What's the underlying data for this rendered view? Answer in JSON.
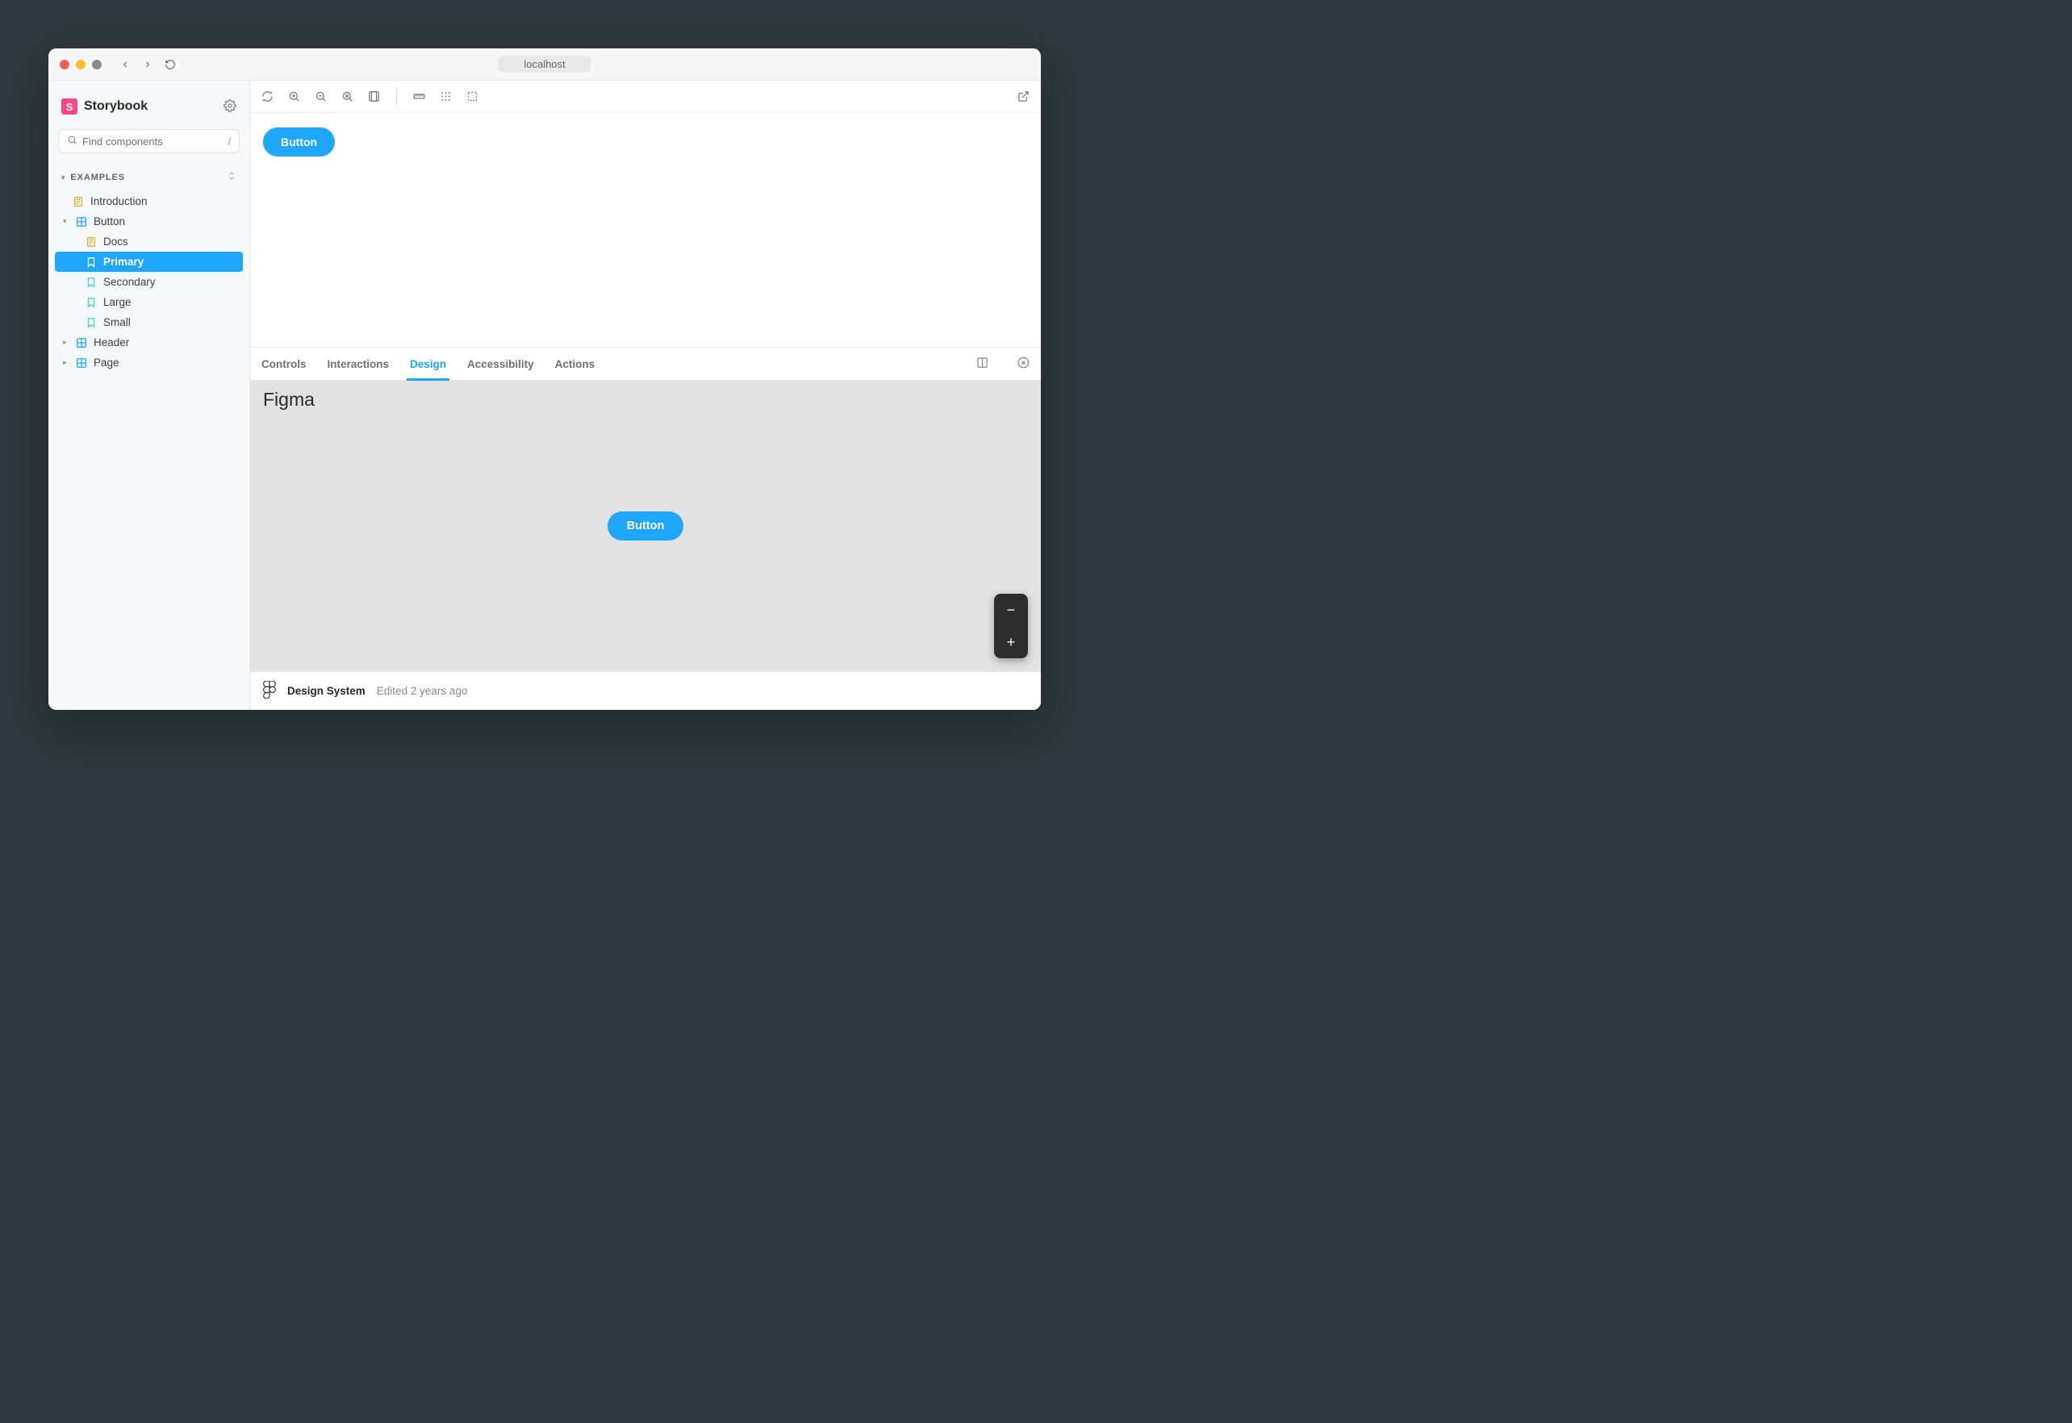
{
  "browser": {
    "url": "localhost"
  },
  "sidebar": {
    "brand": "Storybook",
    "search_placeholder": "Find components",
    "search_shortcut": "/",
    "section_label": "EXAMPLES",
    "tree": {
      "intro": "Introduction",
      "button": "Button",
      "button_docs": "Docs",
      "button_primary": "Primary",
      "button_secondary": "Secondary",
      "button_large": "Large",
      "button_small": "Small",
      "header": "Header",
      "page": "Page"
    }
  },
  "canvas": {
    "button_label": "Button"
  },
  "addons": {
    "tabs": {
      "controls": "Controls",
      "interactions": "Interactions",
      "design": "Design",
      "accessibility": "Accessibility",
      "actions": "Actions"
    },
    "active_tab": "Design"
  },
  "design_panel": {
    "title": "Figma",
    "preview_label": "Button",
    "file_name": "Design System",
    "edited_meta": "Edited 2 years ago"
  },
  "colors": {
    "accent": "#1ea7fd",
    "brand": "#ff4785"
  }
}
